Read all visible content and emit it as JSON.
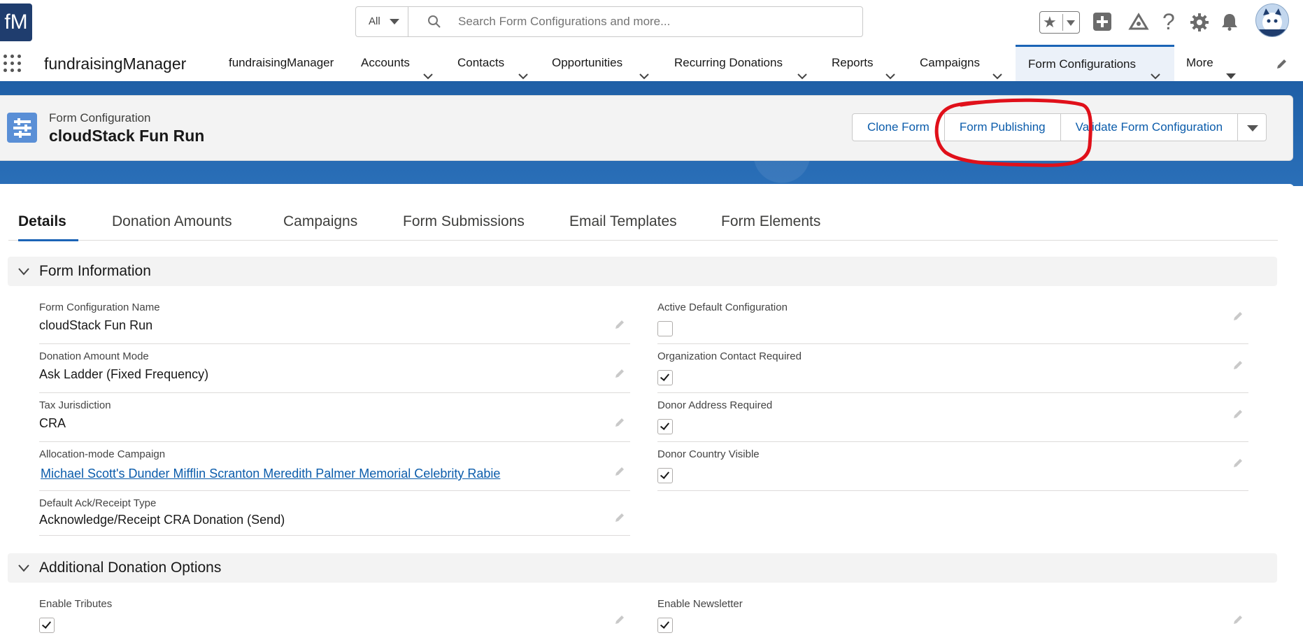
{
  "header": {
    "logo_text": "fM",
    "search_scope": "All",
    "search_placeholder": "Search Form Configurations and more..."
  },
  "nav": {
    "app_name": "fundraisingManager",
    "items": [
      {
        "label": "fundraisingManager"
      },
      {
        "label": "Accounts"
      },
      {
        "label": "Contacts"
      },
      {
        "label": "Opportunities"
      },
      {
        "label": "Recurring Donations"
      },
      {
        "label": "Reports"
      },
      {
        "label": "Campaigns"
      },
      {
        "label": "Form Configurations"
      },
      {
        "label": "More"
      }
    ],
    "active_item": "Form Configurations"
  },
  "record": {
    "object_type": "Form Configuration",
    "title": "cloudStack Fun Run",
    "actions": [
      "Clone Form",
      "Form Publishing",
      "Validate Form Configuration"
    ]
  },
  "tabs": [
    "Details",
    "Donation Amounts",
    "Campaigns",
    "Form Submissions",
    "Email Templates",
    "Form Elements"
  ],
  "active_tab": "Details",
  "sections": {
    "form_information": {
      "title": "Form Information",
      "left_fields": [
        {
          "label": "Form Configuration Name",
          "value": "cloudStack Fun Run"
        },
        {
          "label": "Donation Amount Mode",
          "value": "Ask Ladder (Fixed Frequency)"
        },
        {
          "label": "Tax Jurisdiction",
          "value": "CRA"
        },
        {
          "label": "Allocation-mode Campaign",
          "value": "Michael Scott's Dunder Mifflin Scranton Meredith Palmer Memorial Celebrity Rabie"
        },
        {
          "label": "Default Ack/Receipt Type",
          "value": "Acknowledge/Receipt CRA Donation (Send)"
        }
      ],
      "right_fields": [
        {
          "label": "Active Default Configuration",
          "checked": false
        },
        {
          "label": "Organization Contact Required",
          "checked": true
        },
        {
          "label": "Donor Address Required",
          "checked": true
        },
        {
          "label": "Donor Country Visible",
          "checked": true
        }
      ]
    },
    "additional_donation_options": {
      "title": "Additional Donation Options",
      "left_fields": [
        {
          "label": "Enable Tributes",
          "checked": true
        }
      ],
      "right_fields": [
        {
          "label": "Enable Newsletter",
          "checked": true
        }
      ]
    }
  },
  "colors": {
    "brand_blue": "#1b64b6",
    "link_blue": "#0b5cab",
    "annotation_red": "#e0101a"
  }
}
